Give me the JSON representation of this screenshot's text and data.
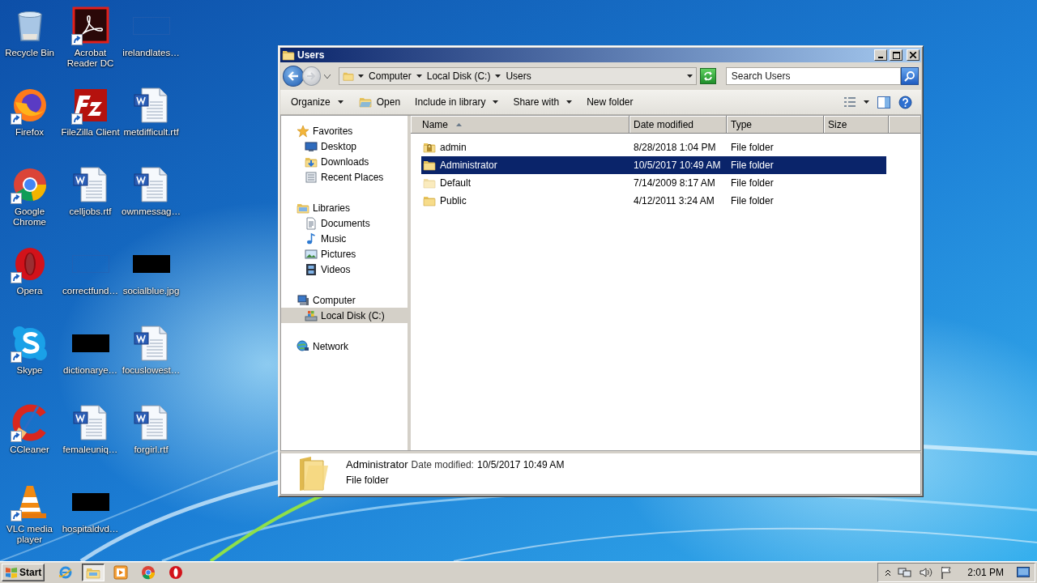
{
  "desktop_icons": [
    {
      "label": "Recycle Bin",
      "kind": "recycle",
      "shortcut": false
    },
    {
      "label": "Firefox",
      "kind": "firefox",
      "shortcut": true
    },
    {
      "label": "Google Chrome",
      "kind": "chrome",
      "shortcut": true
    },
    {
      "label": "Opera",
      "kind": "opera",
      "shortcut": true
    },
    {
      "label": "Skype",
      "kind": "skype",
      "shortcut": true
    },
    {
      "label": "CCleaner",
      "kind": "ccleaner",
      "shortcut": true
    },
    {
      "label": "VLC media player",
      "kind": "vlc",
      "shortcut": true
    },
    {
      "label": "Acrobat Reader DC",
      "kind": "acrobat",
      "shortcut": true
    },
    {
      "label": "FileZilla Client",
      "kind": "filezilla",
      "shortcut": true
    },
    {
      "label": "celljobs.rtf",
      "kind": "word",
      "shortcut": false
    },
    {
      "label": "correctfund…",
      "kind": "blank-image",
      "shortcut": false
    },
    {
      "label": "dictionarye…",
      "kind": "black-image",
      "shortcut": false
    },
    {
      "label": "femaleuniq…",
      "kind": "word",
      "shortcut": false
    },
    {
      "label": "hospitaldvd…",
      "kind": "black-image",
      "shortcut": false
    },
    {
      "label": "irelandlates…",
      "kind": "blank-image",
      "shortcut": false
    },
    {
      "label": "metdifficult.rtf",
      "kind": "word",
      "shortcut": false
    },
    {
      "label": "ownmessag…",
      "kind": "word",
      "shortcut": false
    },
    {
      "label": "socialblue.jpg",
      "kind": "black-image",
      "shortcut": false
    },
    {
      "label": "focuslowest…",
      "kind": "word",
      "shortcut": false
    },
    {
      "label": "forgirl.rtf",
      "kind": "word",
      "shortcut": false
    }
  ],
  "window": {
    "title": "Users",
    "address": {
      "crumbs": [
        "Computer",
        "Local Disk (C:)",
        "Users"
      ]
    },
    "search": {
      "placeholder": "Search Users"
    },
    "toolbar": [
      {
        "label": "Organize",
        "kind": "menu"
      },
      {
        "label": "Open",
        "kind": "open"
      },
      {
        "label": "Include in library",
        "kind": "menu"
      },
      {
        "label": "Share with",
        "kind": "menu"
      },
      {
        "label": "New folder",
        "kind": "plain"
      }
    ],
    "nav": [
      {
        "label": "Favorites",
        "kind": "star",
        "selected": false,
        "children": [
          {
            "label": "Desktop",
            "kind": "desktop",
            "selected": false
          },
          {
            "label": "Downloads",
            "kind": "downloads",
            "selected": false
          },
          {
            "label": "Recent Places",
            "kind": "recent",
            "selected": false
          }
        ]
      },
      {
        "label": "Libraries",
        "kind": "library",
        "selected": false,
        "children": [
          {
            "label": "Documents",
            "kind": "documents",
            "selected": false
          },
          {
            "label": "Music",
            "kind": "music",
            "selected": false
          },
          {
            "label": "Pictures",
            "kind": "pictures",
            "selected": false
          },
          {
            "label": "Videos",
            "kind": "videos",
            "selected": false
          }
        ]
      },
      {
        "label": "Computer",
        "kind": "computer",
        "selected": false,
        "children": [
          {
            "label": "Local Disk (C:)",
            "kind": "disk",
            "selected": true
          }
        ]
      },
      {
        "label": "Network",
        "kind": "network",
        "selected": false
      }
    ],
    "columns": [
      {
        "label": "Name",
        "sorted": true
      },
      {
        "label": "Date modified",
        "sorted": false
      },
      {
        "label": "Type",
        "sorted": false
      },
      {
        "label": "Size",
        "sorted": false
      }
    ],
    "rows": [
      {
        "name": "admin",
        "date": "8/28/2018 1:04 PM",
        "type": "File folder",
        "kind": "locked",
        "selected": false
      },
      {
        "name": "Administrator",
        "date": "10/5/2017 10:49 AM",
        "type": "File folder",
        "kind": "folder",
        "selected": true
      },
      {
        "name": "Default",
        "date": "7/14/2009 8:17 AM",
        "type": "File folder",
        "kind": "hidden",
        "selected": false
      },
      {
        "name": "Public",
        "date": "4/12/2011 3:24 AM",
        "type": "File folder",
        "kind": "folder",
        "selected": false
      }
    ],
    "details": {
      "name": "Administrator",
      "date_label": "Date modified:",
      "date": "10/5/2017 10:49 AM",
      "type": "File folder"
    }
  },
  "taskbar": {
    "start": "Start",
    "apps": [
      {
        "kind": "ie",
        "active": false
      },
      {
        "kind": "explorer",
        "active": true
      },
      {
        "kind": "media",
        "active": false
      },
      {
        "kind": "chrome",
        "active": false
      },
      {
        "kind": "opera",
        "active": false
      }
    ],
    "clock": "2:01 PM"
  }
}
